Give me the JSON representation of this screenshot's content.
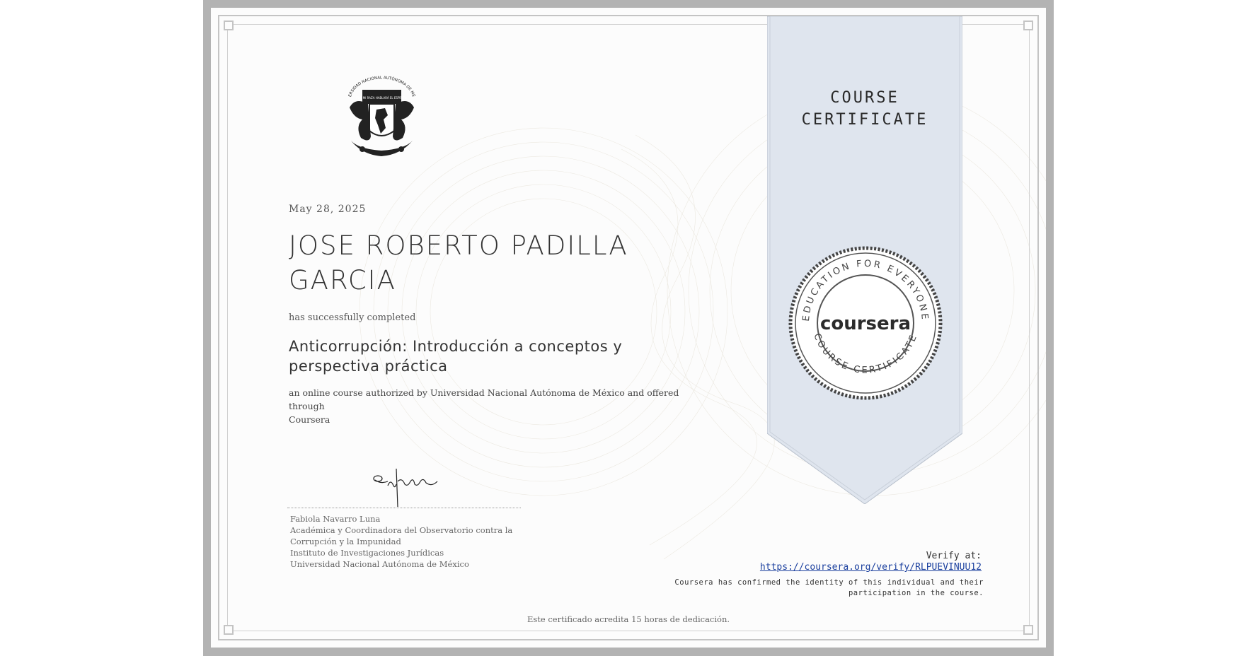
{
  "certificate": {
    "ribbon_title_line1": "COURSE",
    "ribbon_title_line2": "CERTIFICATE",
    "date": "May 28, 2025",
    "recipient_line1": "JOSE ROBERTO PADILLA",
    "recipient_line2": "GARCIA",
    "completed_text": "has successfully completed",
    "course_line1": "Anticorrupción: Introducción a conceptos y",
    "course_line2": "perspectiva práctica",
    "authorized_line1": "an online course authorized by Universidad Nacional Autónoma de México and offered through",
    "authorized_line2": "Coursera"
  },
  "seal": {
    "brand": "coursera",
    "top_arc": "EDUCATION FOR EVERYONE",
    "bottom_arc": "COURSE CERTIFICATE"
  },
  "logo": {
    "text": "UNIVERSIDAD NACIONAL AUTÓNOMA DE MÉXICO",
    "motto": "POR MI RAZA HABLARÁ EL ESPÍRITU"
  },
  "signer": {
    "name": "Fabiola Navarro Luna",
    "title_line1": "Académica y Coordinadora del Observatorio contra la",
    "title_line2": "Corrupción y la Impunidad",
    "institute": "Instituto de Investigaciones Jurídicas",
    "university": "Universidad Nacional Autónoma de México"
  },
  "verify": {
    "label": "Verify at:",
    "url": "https://coursera.org/verify/RLPUEVINUU12",
    "note_line1": "Coursera has confirmed the identity of this individual and their",
    "note_line2": "participation in the course."
  },
  "footer": {
    "hours": "Este certificado acredita 15 horas de dedicación."
  },
  "colors": {
    "ribbon": "#dfe5ee",
    "frame": "#b3b3b3",
    "link": "#1a3f9e"
  }
}
